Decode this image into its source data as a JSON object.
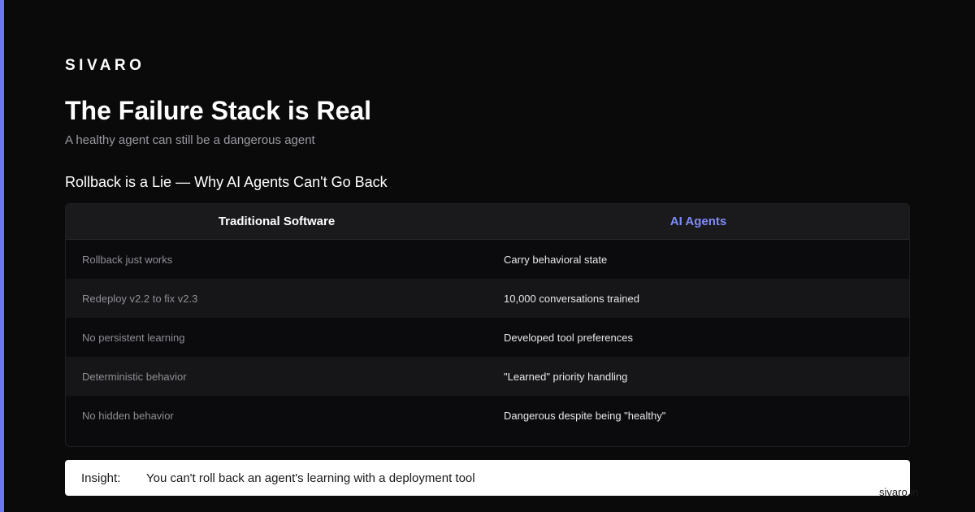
{
  "brand": {
    "name": "SIVARO",
    "watermark": "sivaro.in"
  },
  "header": {
    "title": "The Failure Stack is Real",
    "subtitle": "A healthy agent can still be a dangerous agent"
  },
  "section": {
    "heading": "Rollback is a Lie — Why AI Agents Can't Go Back"
  },
  "table": {
    "headers": [
      "Traditional Software",
      "AI Agents"
    ],
    "rows": [
      [
        "Rollback just works",
        "Carry behavioral state"
      ],
      [
        "Redeploy v2.2 to fix v2.3",
        "10,000 conversations trained"
      ],
      [
        "No persistent learning",
        "Developed tool preferences"
      ],
      [
        "Deterministic behavior",
        "\"Learned\" priority handling"
      ],
      [
        "No hidden behavior",
        "Dangerous despite being \"healthy\""
      ]
    ]
  },
  "insight": {
    "label": "Insight:",
    "text": "You can't roll back an agent's learning with a deployment tool"
  },
  "colors": {
    "accent": "#6d78ef",
    "accent_text": "#7f8cf5",
    "background": "#0a0a0b"
  }
}
